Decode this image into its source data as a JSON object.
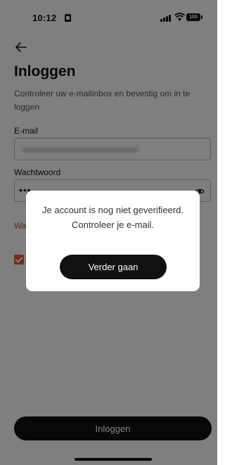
{
  "status_bar": {
    "time": "10:12",
    "battery": "100"
  },
  "header": {
    "title": "Inloggen"
  },
  "subtitle": "Controleer uw e-mailinbox en bevestig om in te loggen",
  "form": {
    "email_label": "E-mail",
    "password_label": "Wachtwoord",
    "password_value": "•••",
    "warning_partial": "Wa"
  },
  "login_button_label": "Inloggen",
  "dialog": {
    "message_line1": "Je account is nog niet geverifieerd.",
    "message_line2": "Controleer je e-mail.",
    "button_label": "Verder gaan"
  },
  "colors": {
    "accent": "#e65a2a",
    "primary": "#111111",
    "overlay": "rgba(0,0,0,0.5)"
  }
}
